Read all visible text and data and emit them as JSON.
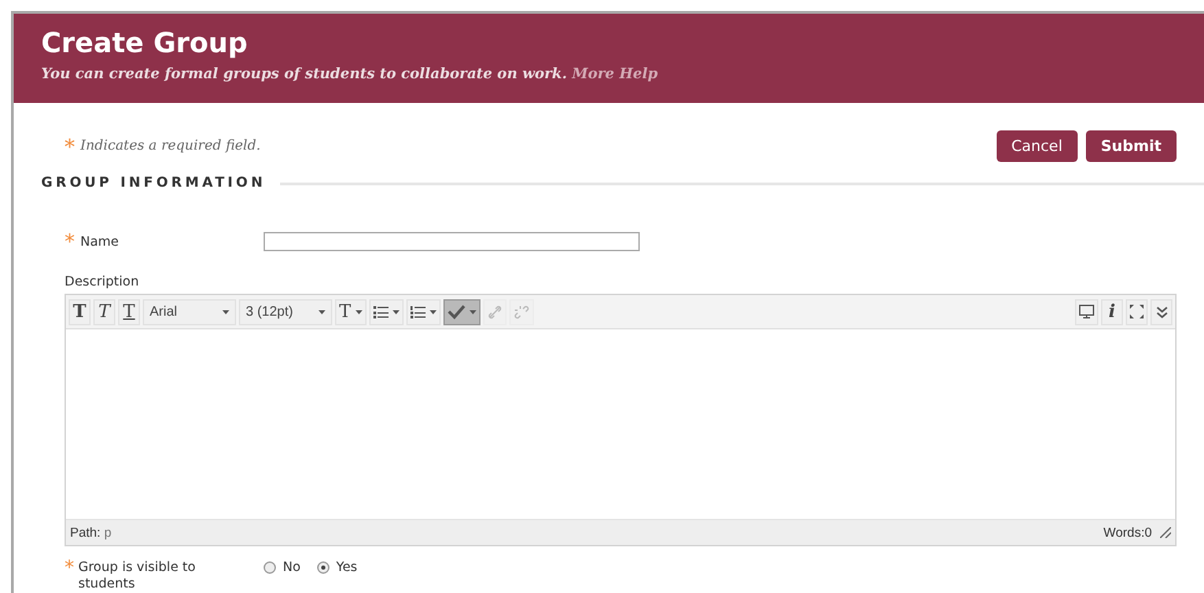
{
  "header": {
    "title": "Create Group",
    "subtitle": "You can create formal groups of students to collaborate on work.",
    "help_link": "More Help"
  },
  "required_note": {
    "mark": "*",
    "text": "Indicates a required field."
  },
  "buttons": [
    {
      "label": "Cancel",
      "primary": false
    },
    {
      "label": "Submit",
      "primary": true
    }
  ],
  "section": {
    "title": "GROUP INFORMATION"
  },
  "name_field": {
    "label": "Name",
    "required": true,
    "mark": "*"
  },
  "description": {
    "label": "Description",
    "toolbar": [
      {
        "kind": "bold",
        "glyph": "T"
      },
      {
        "kind": "italic",
        "glyph": "T"
      },
      {
        "kind": "underline",
        "glyph": "T"
      },
      {
        "kind": "select",
        "value": "Arial"
      },
      {
        "kind": "select",
        "value": "3 (12pt)"
      },
      {
        "kind": "color",
        "glyph": "T"
      },
      {
        "kind": "bullets"
      },
      {
        "kind": "numbers"
      },
      {
        "kind": "spellcheck",
        "pressed": true
      },
      {
        "kind": "link",
        "disabled": true
      },
      {
        "kind": "unlink",
        "disabled": true
      }
    ],
    "toolbar_right": [
      {
        "kind": "preview"
      },
      {
        "kind": "info",
        "glyph": "i"
      },
      {
        "kind": "fullscreen"
      },
      {
        "kind": "collapse"
      }
    ],
    "path_label": "Path:",
    "path_value": "p",
    "word_count": "Words:0"
  },
  "visibility": {
    "label": "Group is visible to students",
    "required": true,
    "mark": "*",
    "options": [
      {
        "label": "No",
        "selected": false
      },
      {
        "label": "Yes",
        "selected": true
      }
    ]
  }
}
